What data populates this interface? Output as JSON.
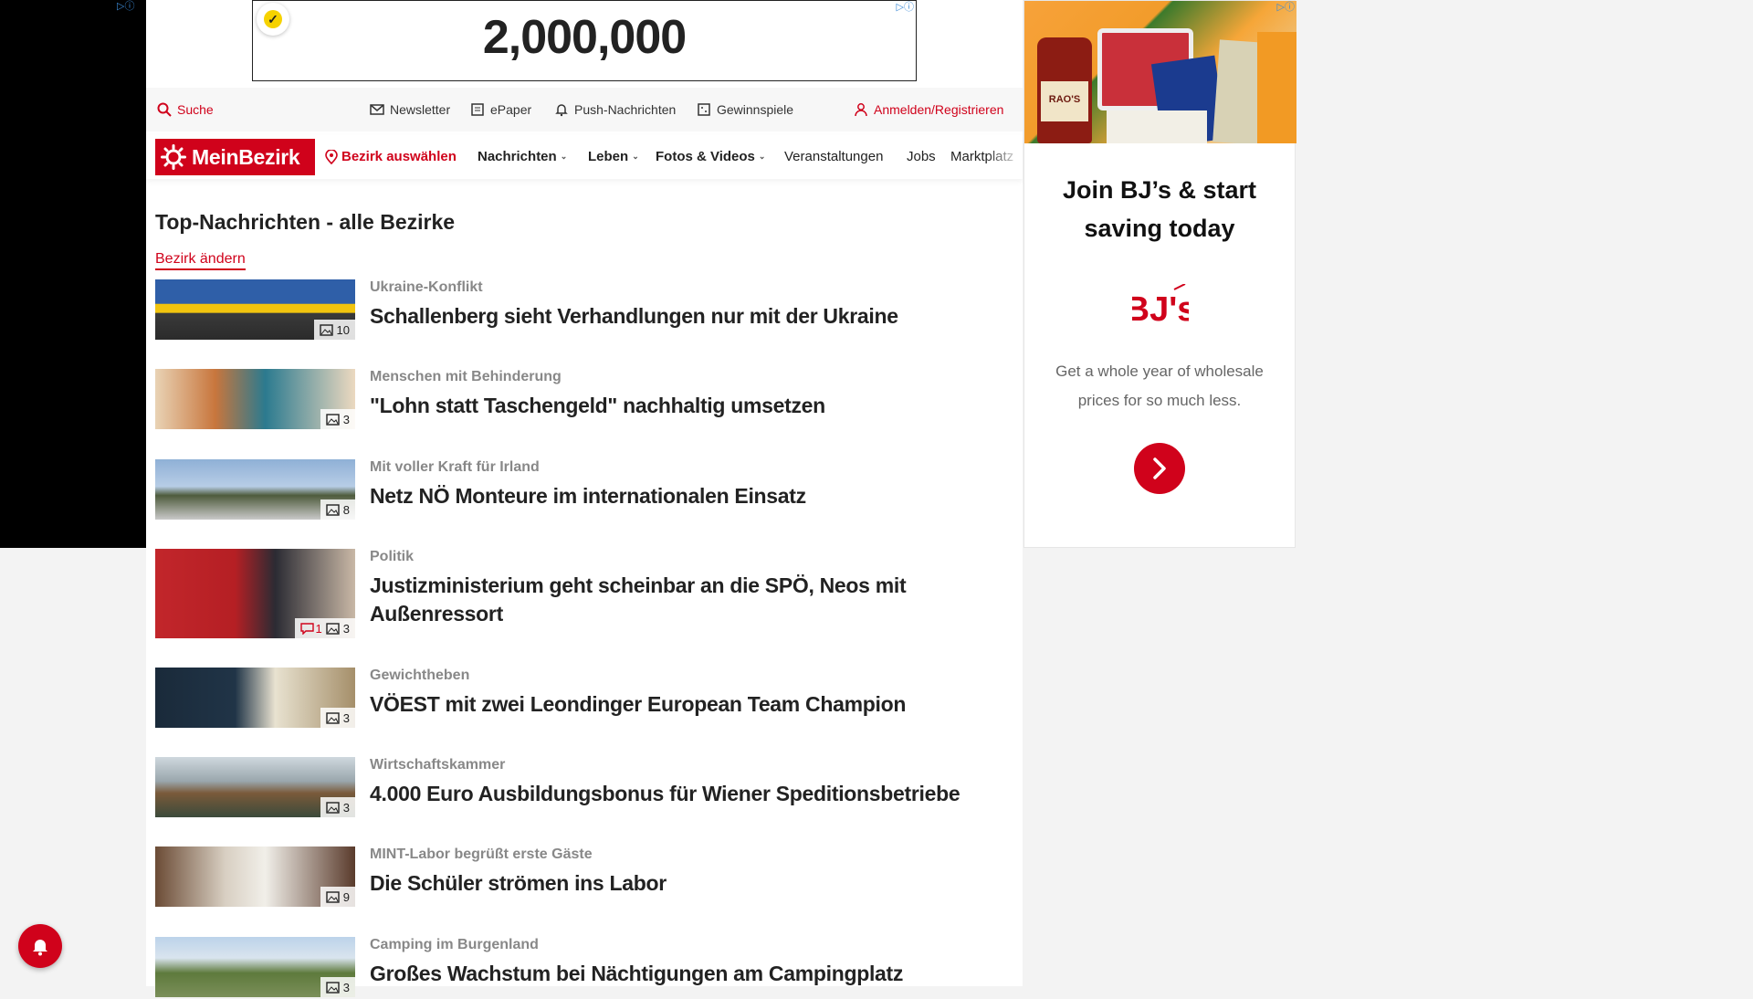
{
  "left_ad": {
    "badge": "▷ⓘ"
  },
  "top_banner": {
    "counter": "2,000,000",
    "badge": "▷ⓘ",
    "check_icon": "check-badge-icon"
  },
  "utility": {
    "search": "Suche",
    "newsletter": "Newsletter",
    "epaper": "ePaper",
    "push": "Push-Nachrichten",
    "gewinnspiele": "Gewinnspiele",
    "login": "Anmelden/Registrieren"
  },
  "nav": {
    "logo": "MeinBezirk",
    "district_select": "Bezirk auswählen",
    "nachrichten": "Nachrichten",
    "leben": "Leben",
    "fotos": "Fotos & Videos",
    "veranstaltungen": "Veranstaltungen",
    "jobs": "Jobs",
    "marktplatz": "Marktplatz"
  },
  "section": {
    "title": "Top-Nachrichten - alle Bezirke",
    "change_link": "Bezirk ändern"
  },
  "articles": [
    {
      "kicker": "Ukraine-Konflikt",
      "headline": "Schallenberg sieht Verhandlungen nur mit der Ukraine",
      "photos": "10",
      "comments": ""
    },
    {
      "kicker": "Menschen mit Behinderung",
      "headline": "\"Lohn statt Taschengeld\" nachhaltig umsetzen",
      "photos": "3",
      "comments": ""
    },
    {
      "kicker": "Mit voller Kraft für Irland",
      "headline": "Netz NÖ Monteure im internationalen Einsatz",
      "photos": "8",
      "comments": ""
    },
    {
      "kicker": "Politik",
      "headline": "Justizministerium geht scheinbar an die SPÖ, Neos mit Außenressort",
      "photos": "3",
      "comments": "1"
    },
    {
      "kicker": "Gewichtheben",
      "headline": "VÖEST mit zwei Leondinger European Team Champion",
      "photos": "3",
      "comments": ""
    },
    {
      "kicker": "Wirtschaftskammer",
      "headline": "4.000 Euro Ausbildungsbonus für Wiener Speditionsbetriebe",
      "photos": "3",
      "comments": ""
    },
    {
      "kicker": "MINT-Labor begrüßt erste Gäste",
      "headline": "Die Schüler strömen ins Labor",
      "photos": "9",
      "comments": ""
    },
    {
      "kicker": "Camping im Burgenland",
      "headline": "Großes Wachstum bei Nächtigungen am Campingplatz",
      "photos": "3",
      "comments": ""
    }
  ],
  "right_ad": {
    "badge": "▷ⓘ",
    "jar_label": "RAO'S",
    "title_line1": "Join BJ’s & start",
    "title_line2": "saving today",
    "logo": "BJ's",
    "copy_line1": "Get a whole year of wholesale",
    "copy_line2": "prices for so much less.",
    "cta_icon": "chevron-right-icon"
  },
  "colors": {
    "brand": "#d0021b",
    "kicker": "#888888"
  }
}
